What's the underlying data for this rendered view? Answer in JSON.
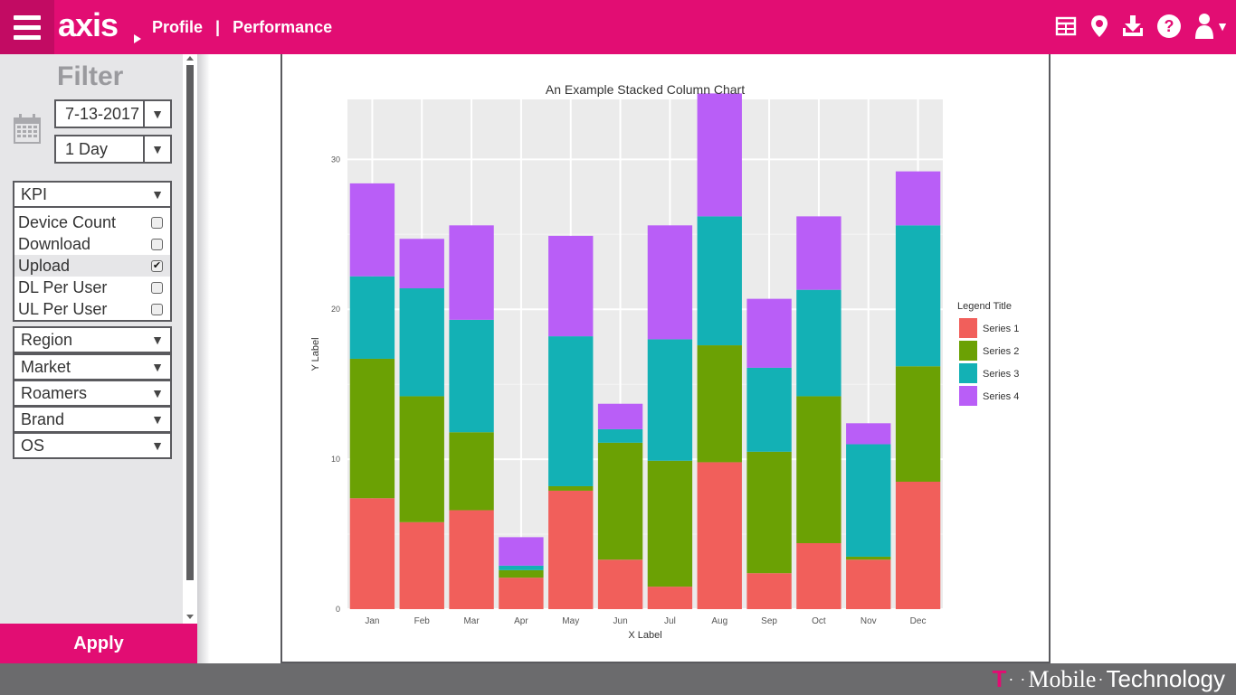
{
  "header": {
    "logo": "axis",
    "nav": [
      "Profile",
      "Performance"
    ],
    "nav_separator": "|",
    "icons": [
      "table-icon",
      "map-pin-icon",
      "download-icon",
      "help-icon",
      "user-icon",
      "chevron-down-icon"
    ],
    "accent_color": "#e20d73"
  },
  "sidebar": {
    "title": "Filter",
    "date_value": "7-13-2017",
    "period_value": "1 Day",
    "kpi_label": "KPI",
    "kpi_items": [
      {
        "label": "Device Count",
        "checked": false
      },
      {
        "label": "Download",
        "checked": false
      },
      {
        "label": "Upload",
        "checked": true
      },
      {
        "label": "DL Per User",
        "checked": false
      },
      {
        "label": "UL Per User",
        "checked": false
      }
    ],
    "dropdowns": [
      "Region",
      "Market",
      "Roamers",
      "Brand",
      "OS"
    ],
    "apply_label": "Apply"
  },
  "footer": {
    "brand_t": "T",
    "brand_dots": "· ·",
    "brand_mobile": "Mobile",
    "brand_sep": "·",
    "brand_tech": "Technology"
  },
  "chart_data": {
    "type": "bar",
    "stacked": true,
    "title": "An Example Stacked Column Chart",
    "xlabel": "X Label",
    "ylabel": "Y Label",
    "ylim": [
      0,
      34
    ],
    "yticks": [
      0,
      10,
      20,
      30
    ],
    "grid": true,
    "legend_title": "Legend Title",
    "legend_position": "right",
    "categories": [
      "Jan",
      "Feb",
      "Mar",
      "Apr",
      "May",
      "Jun",
      "Jul",
      "Aug",
      "Sep",
      "Oct",
      "Nov",
      "Dec"
    ],
    "series": [
      {
        "name": "Series 1",
        "color": "#f15f5b",
        "values": [
          7.4,
          5.8,
          6.6,
          2.1,
          7.9,
          3.3,
          1.5,
          9.8,
          2.4,
          4.4,
          3.3,
          8.5
        ]
      },
      {
        "name": "Series 2",
        "color": "#6ba104",
        "values": [
          9.3,
          8.4,
          5.2,
          0.5,
          0.3,
          7.8,
          8.4,
          7.8,
          8.1,
          9.8,
          0.2,
          7.7
        ]
      },
      {
        "name": "Series 3",
        "color": "#13b1b5",
        "values": [
          5.5,
          7.2,
          7.5,
          0.3,
          10.0,
          0.9,
          8.1,
          8.6,
          5.6,
          7.1,
          7.5,
          9.4
        ]
      },
      {
        "name": "Series 4",
        "color": "#b95ef7",
        "values": [
          6.2,
          3.3,
          6.3,
          1.9,
          6.7,
          1.7,
          7.6,
          8.2,
          4.6,
          4.9,
          1.4,
          3.6
        ]
      }
    ]
  }
}
